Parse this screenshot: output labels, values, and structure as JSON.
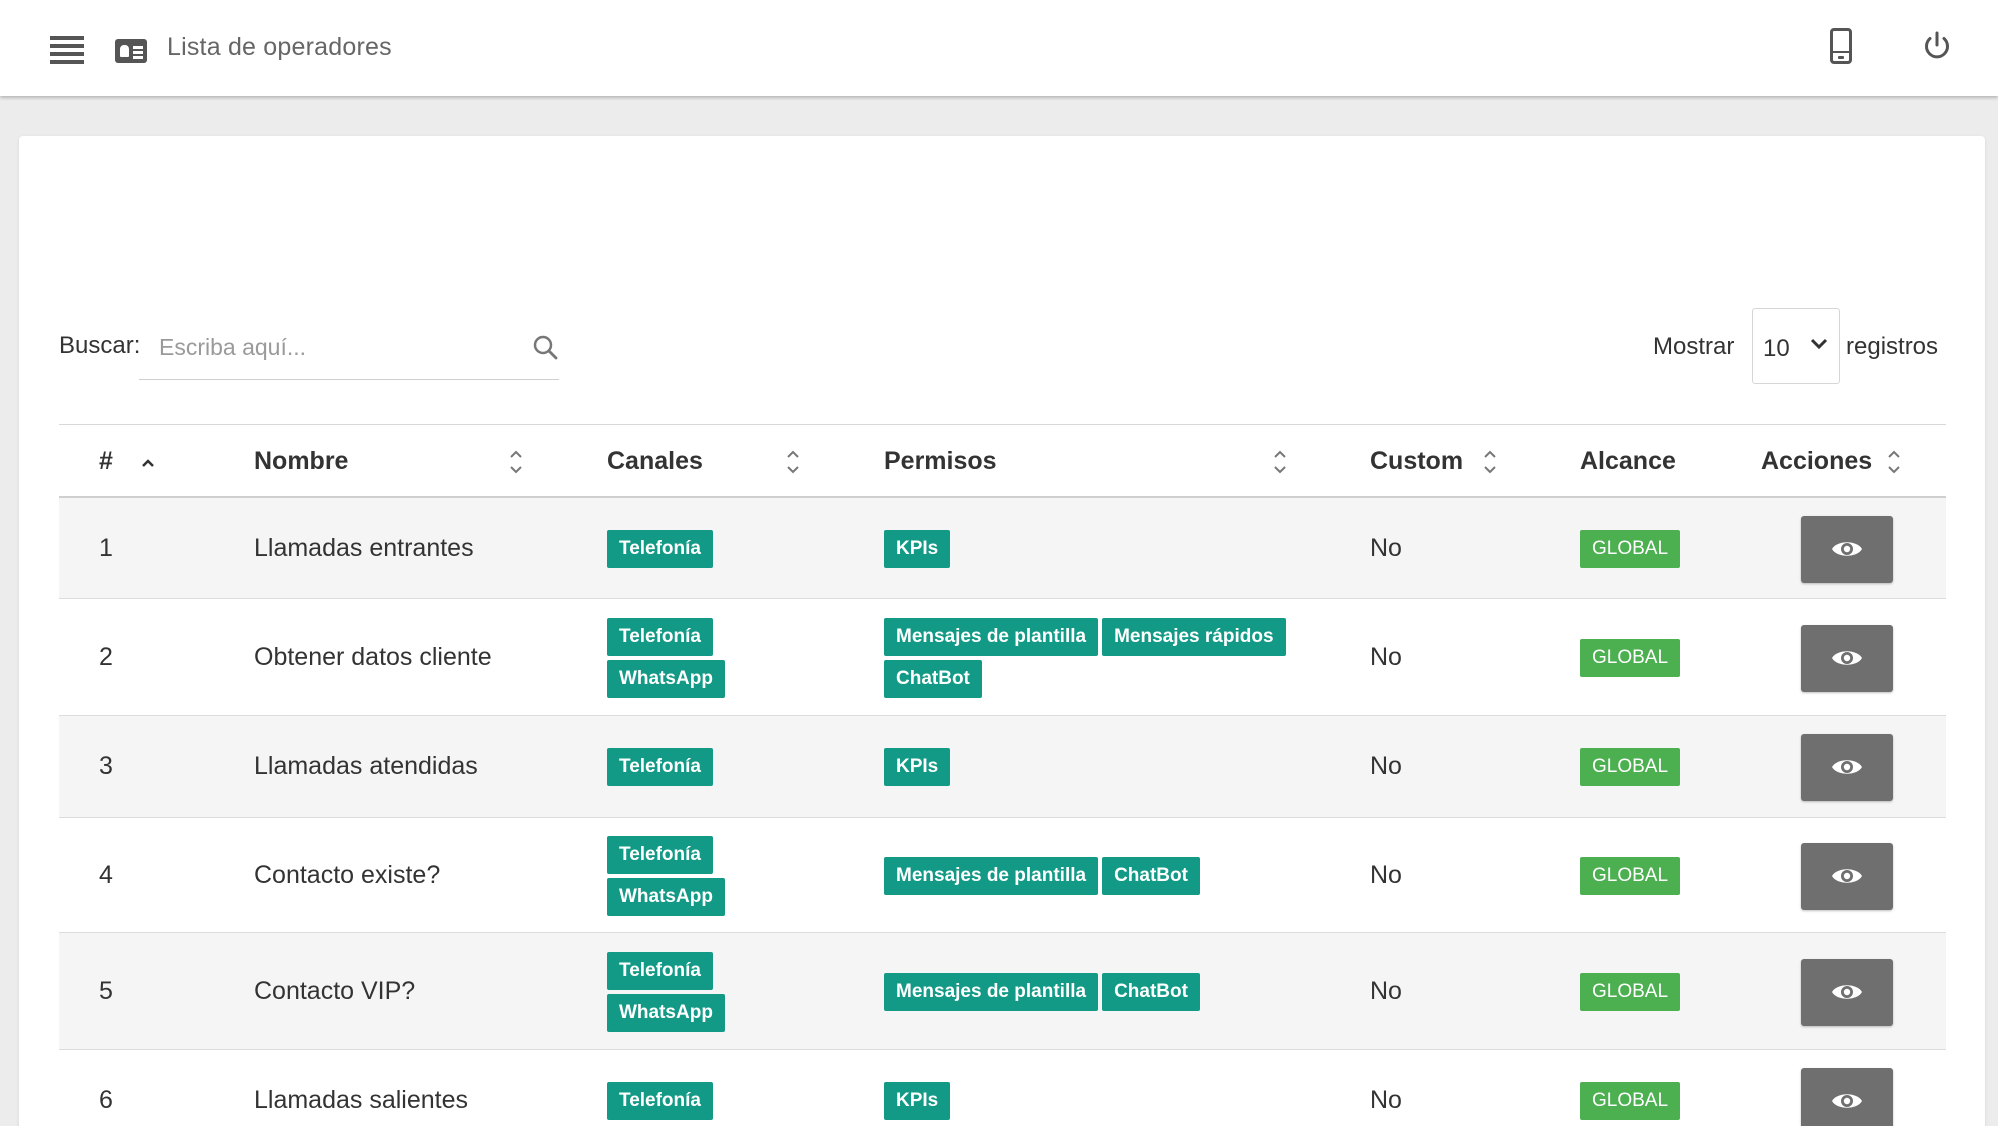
{
  "header": {
    "title": "Lista de operadores",
    "icons": {
      "menu": "menu-icon",
      "section": "id-card-icon",
      "device": "mobile-phone-icon",
      "logout": "power-icon"
    }
  },
  "toolbar": {
    "search_label": "Buscar:",
    "search_placeholder": "Escriba aquí...",
    "search_value": "",
    "show_label": "Mostrar",
    "page_size": "10",
    "records_label": "registros"
  },
  "table": {
    "columns": {
      "num": "#",
      "name": "Nombre",
      "channels": "Canales",
      "permissions": "Permisos",
      "custom": "Custom",
      "scope": "Alcance",
      "actions": "Acciones"
    },
    "rows": [
      {
        "num": "1",
        "name": "Llamadas entrantes",
        "channels": [
          "Telefonía"
        ],
        "permissions": [
          "KPIs"
        ],
        "custom": "No",
        "scope": "GLOBAL"
      },
      {
        "num": "2",
        "name": "Obtener datos cliente",
        "channels": [
          "Telefonía",
          "WhatsApp"
        ],
        "permissions": [
          "Mensajes de plantilla",
          "Mensajes rápidos",
          "ChatBot"
        ],
        "custom": "No",
        "scope": "GLOBAL"
      },
      {
        "num": "3",
        "name": "Llamadas atendidas",
        "channels": [
          "Telefonía"
        ],
        "permissions": [
          "KPIs"
        ],
        "custom": "No",
        "scope": "GLOBAL"
      },
      {
        "num": "4",
        "name": "Contacto existe?",
        "channels": [
          "Telefonía",
          "WhatsApp"
        ],
        "permissions": [
          "Mensajes de plantilla",
          "ChatBot"
        ],
        "custom": "No",
        "scope": "GLOBAL"
      },
      {
        "num": "5",
        "name": "Contacto VIP?",
        "channels": [
          "Telefonía",
          "WhatsApp"
        ],
        "permissions": [
          "Mensajes de plantilla",
          "ChatBot"
        ],
        "custom": "No",
        "scope": "GLOBAL"
      },
      {
        "num": "6",
        "name": "Llamadas salientes",
        "channels": [
          "Telefonía"
        ],
        "permissions": [
          "KPIs"
        ],
        "custom": "No",
        "scope": "GLOBAL"
      }
    ]
  },
  "colors": {
    "channel_badge": "#129a86",
    "scope_badge": "#4caf50",
    "view_button": "#6f6f6f"
  }
}
